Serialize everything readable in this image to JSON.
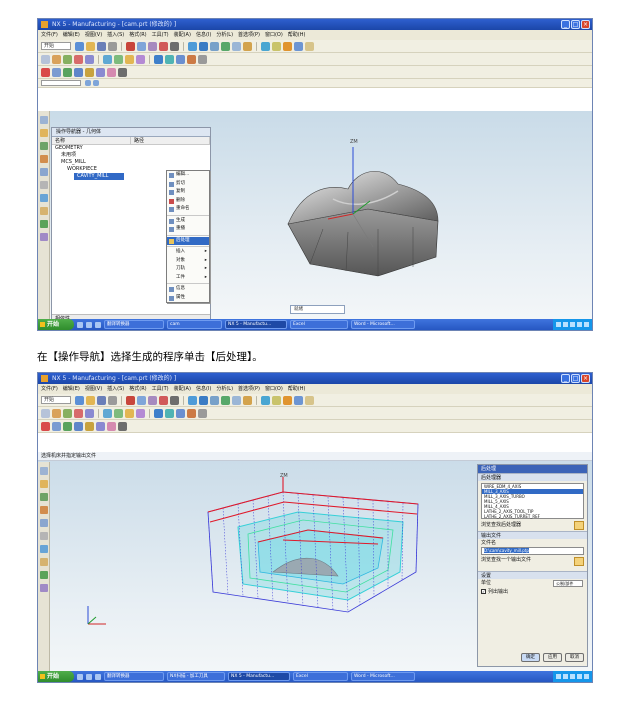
{
  "screenshot1": {
    "title": "NX 5 - Manufacturing - [cam.prt (修改的) ]",
    "menu": [
      "文件(F)",
      "编辑(E)",
      "视图(V)",
      "插入(S)",
      "格式(R)",
      "工具(T)",
      "装配(A)",
      "信息(I)",
      "分析(L)",
      "首选项(P)",
      "窗口(O)",
      "帮助(H)"
    ],
    "start_label": "开始",
    "navigator": {
      "header": "操作导航器 - 几何体",
      "columns": [
        "名称",
        "路径"
      ],
      "rows": [
        "GEOMETRY",
        "未用项",
        "MCS_MILL",
        "WORKPIECE",
        "CAVITY_MILL"
      ],
      "footer_label": "相依性",
      "detail_label": "细节"
    },
    "context_menu": [
      "编辑...",
      "剪切",
      "复制",
      "删除",
      "重命名",
      "生成",
      "重播",
      "后处理",
      "插入",
      "对象",
      "刀轨",
      "工件",
      "信息",
      "属性"
    ],
    "highlighted_item": "后处理",
    "submenu_items": [
      "插入",
      "对象",
      "刀轨",
      "工件"
    ],
    "status": "就绪",
    "taskbar": {
      "start": "开始",
      "tasks": [
        "翻译转换器",
        "cam",
        "NX 5 - Manufactu...",
        "Excel",
        "Word - Microsoft..."
      ],
      "active_task": "NX 5 - Manufactu..."
    },
    "axis_label": "ZM"
  },
  "caption": "在【操作导航】选择生成的程序单击【后处理】。",
  "screenshot2": {
    "title": "NX 5 - Manufacturing - [cam.prt (修改的) ]",
    "menu": [
      "文件(F)",
      "编辑(E)",
      "视图(V)",
      "插入(S)",
      "格式(R)",
      "工具(T)",
      "装配(A)",
      "信息(I)",
      "分析(L)",
      "首选项(P)",
      "窗口(O)",
      "帮助(H)"
    ],
    "start_label": "开始",
    "prompt": "选择机床并指定输出文件",
    "post_panel": {
      "title": "后处理",
      "section_postprocessor": "后处理器",
      "postprocessors": [
        "WIRE_EDM_4_AXIS",
        "MILL_3_AXIS",
        "MILL_3_AXIS_TURBO",
        "MILL_5_AXIS",
        "MILL_4_AXIS",
        "LATHE_2_AXIS_TOOL_TIP",
        "LATHE_2_AXIS_TURRET_REF",
        "MILLTURN"
      ],
      "selected_postprocessor": "MILL_3_AXIS",
      "browse_post_label": "浏览查找后处理器",
      "section_output": "输出文件",
      "filename_label": "文件名",
      "filename": "D:\\cam\\cavity_mill.ptp",
      "browse_output_label": "浏览查找一个输出文件",
      "section_settings": "设置",
      "units_label": "单位",
      "units_value": "公制/部件",
      "list_output_label": "列出输出",
      "list_output_checked": true,
      "ok": "确定",
      "apply": "应用",
      "cancel": "取消"
    },
    "taskbar": {
      "start": "开始",
      "tasks": [
        "翻译转换器",
        "NX扫描 - 加工刀具",
        "NX 5 - Manufactu...",
        "Excel",
        "Word - Microsoft..."
      ],
      "active_task": "NX 5 - Manufactu..."
    },
    "axis_label": "ZM"
  },
  "colors": {
    "titlebar": "#1b46a8",
    "menubar": "#ece9d8",
    "selection": "#316ac5",
    "model_gray": "#8c8c8c",
    "toolpath_blue": "#3a3ad8",
    "toolpath_cyan": "#35d0d8",
    "toolpath_red": "#e0192a"
  }
}
